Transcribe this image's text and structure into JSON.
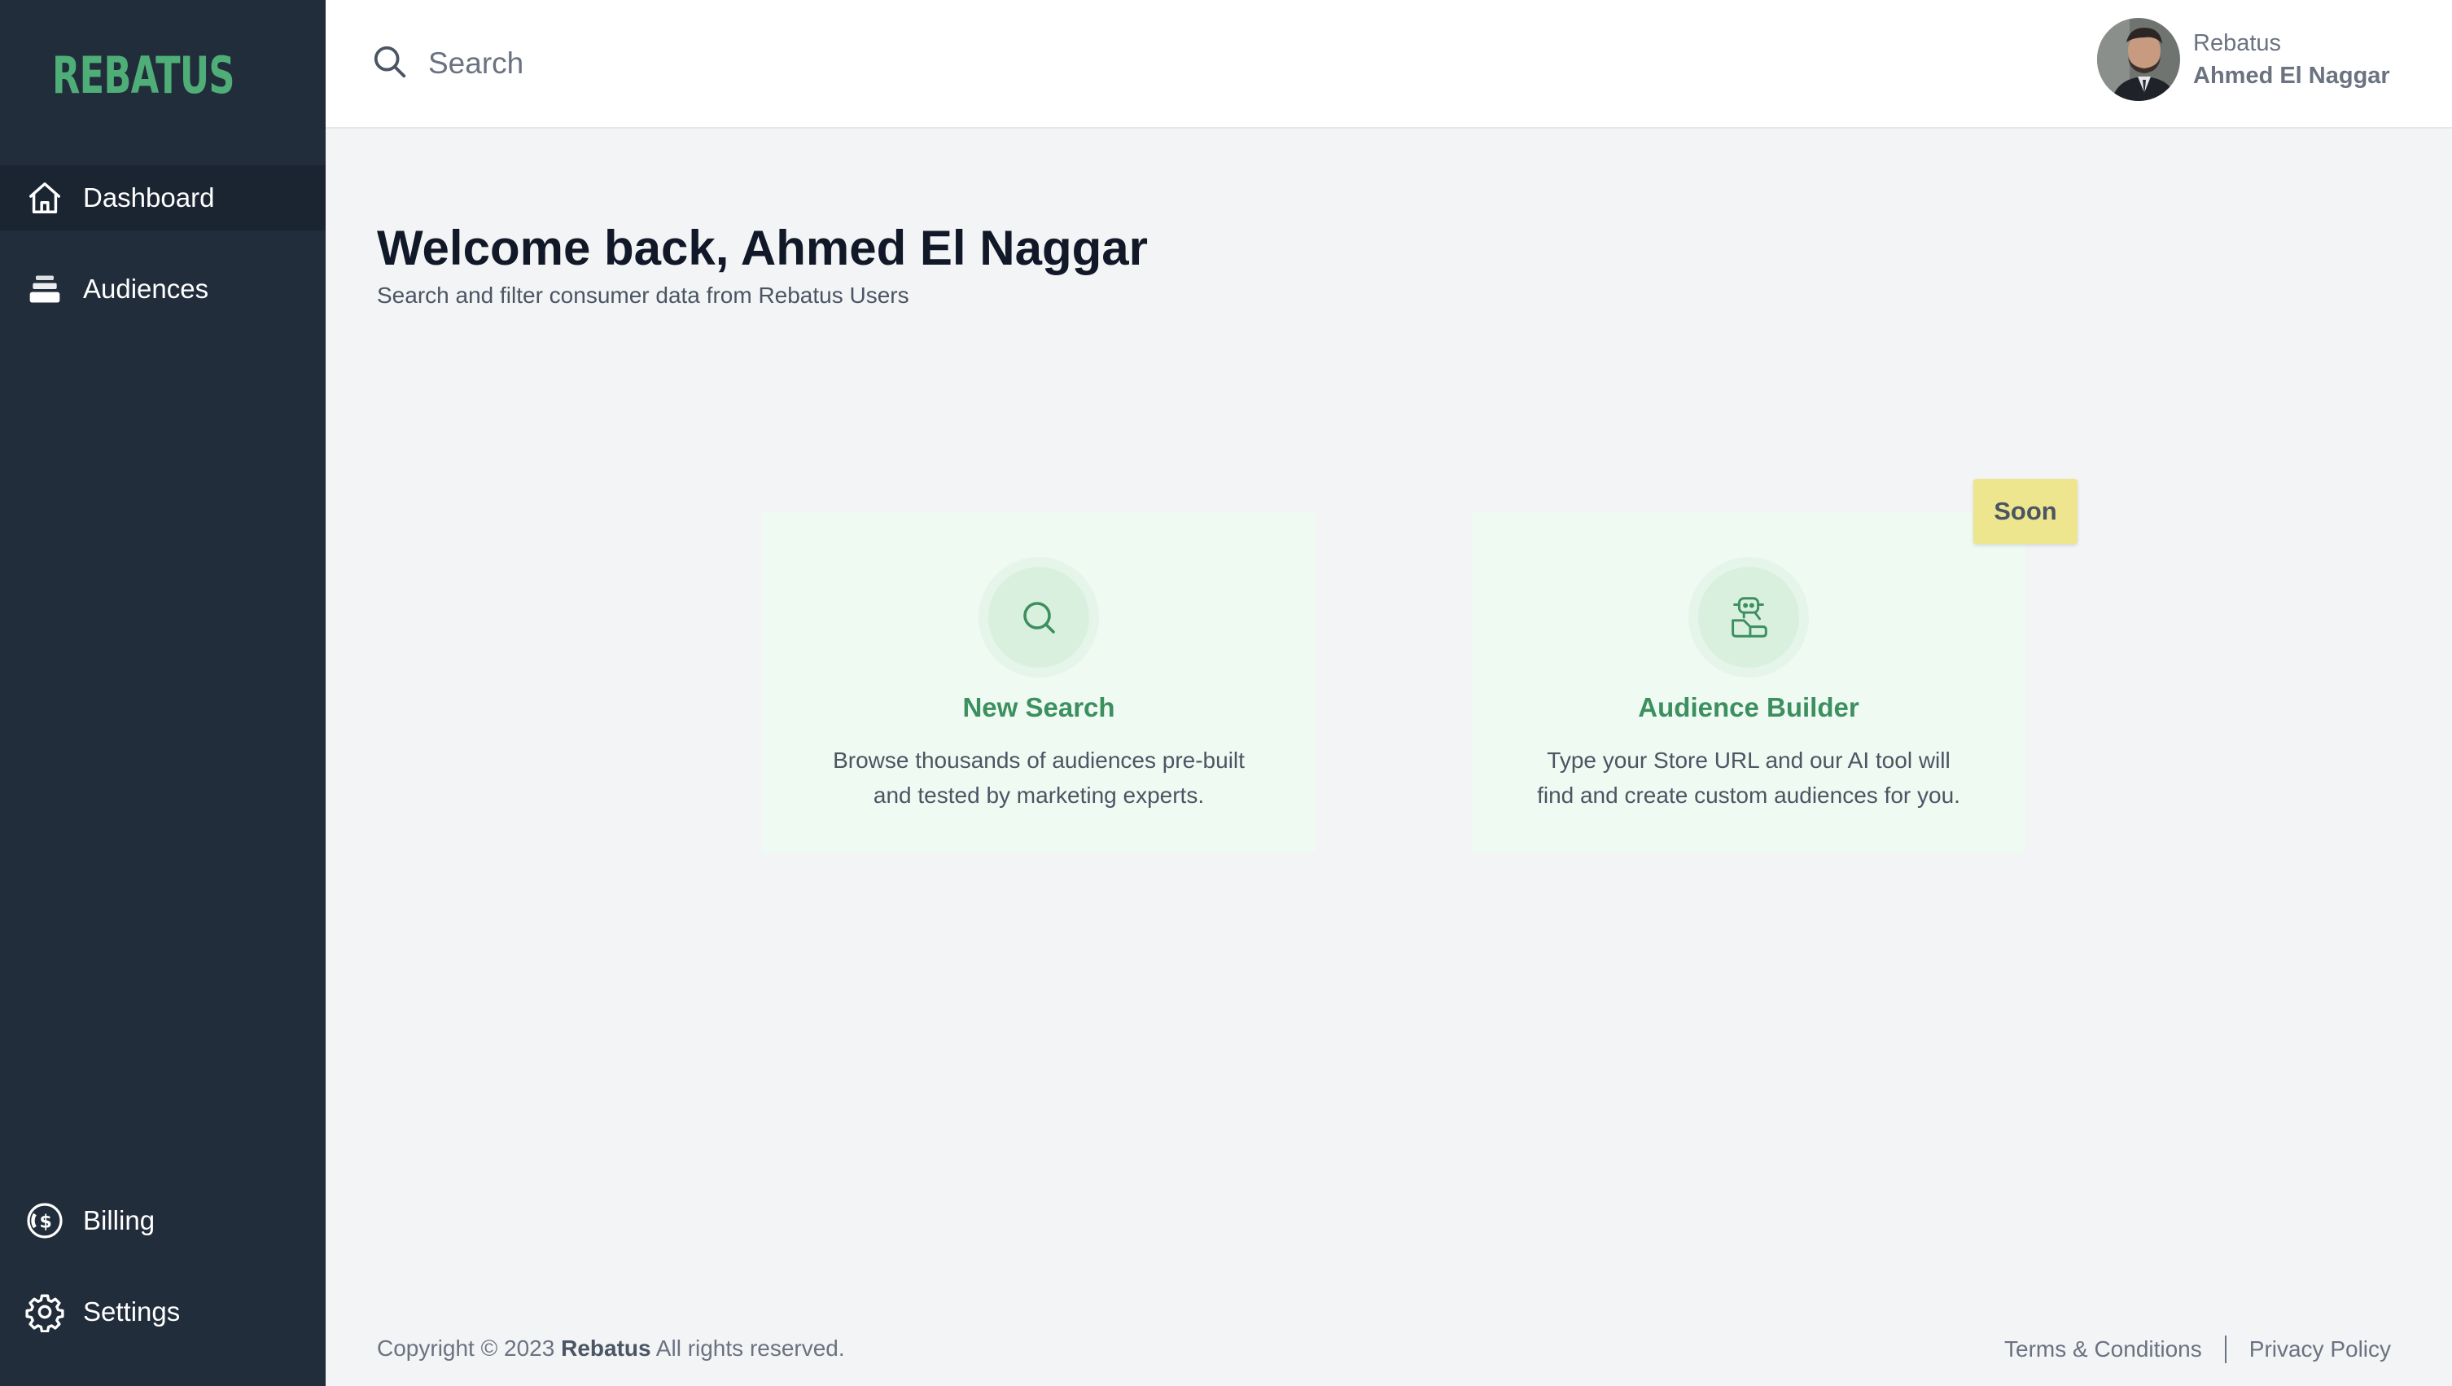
{
  "brand": {
    "logo_text": "REBATUS",
    "accent_color": "#4fae78"
  },
  "sidebar": {
    "items": [
      {
        "label": "Dashboard",
        "icon": "home-icon",
        "active": true
      },
      {
        "label": "Audiences",
        "icon": "stack-icon",
        "active": false
      }
    ],
    "bottom_items": [
      {
        "label": "Billing",
        "icon": "dollar-circle-icon"
      },
      {
        "label": "Settings",
        "icon": "gear-icon"
      }
    ]
  },
  "topbar": {
    "search": {
      "placeholder": "Search",
      "value": ""
    },
    "profile": {
      "org": "Rebatus",
      "name": "Ahmed El Naggar"
    }
  },
  "main": {
    "title": "Welcome back, Ahmed El Naggar",
    "subtitle": "Search and filter consumer data from Rebatus Users",
    "cards": [
      {
        "title": "New Search",
        "description": "Browse thousands of audiences pre-built and tested by marketing experts.",
        "icon": "search-icon"
      },
      {
        "title": "Audience Builder",
        "description": "Type your Store URL and our AI tool will find and create custom audiences for you.",
        "icon": "robot-icon",
        "badge": "Soon"
      }
    ]
  },
  "footer": {
    "copyright_prefix": "Copyright © 2023",
    "copyright_brand": "Rebatus",
    "copyright_suffix": "All rights reserved.",
    "links": [
      "Terms & Conditions",
      "Privacy Policy"
    ]
  }
}
